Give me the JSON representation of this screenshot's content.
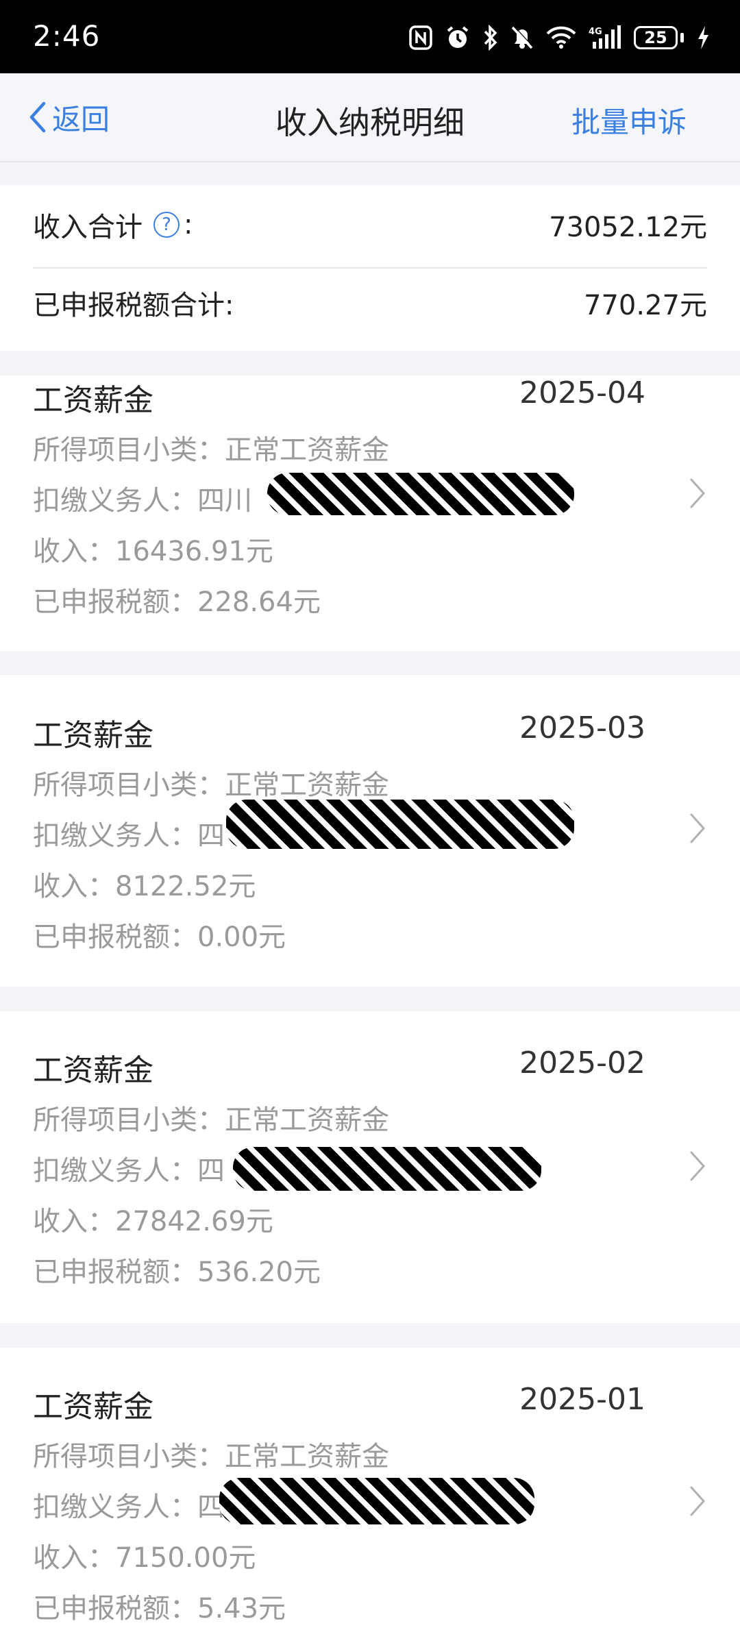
{
  "status_bar": {
    "time": "2:46",
    "battery": "25",
    "icons": [
      "nfc-icon",
      "alarm-icon",
      "bluetooth-icon",
      "mute-icon",
      "wifi-icon",
      "signal-4g-icon",
      "battery-icon",
      "charging-icon"
    ]
  },
  "nav": {
    "back_label": "返回",
    "title": "收入纳税明细",
    "action_label": "批量申诉"
  },
  "summary": {
    "income_label": "收入合计",
    "income_colon": ":",
    "income_value": "73052.12元",
    "tax_label": "已申报税额合计:",
    "tax_value": "770.27元"
  },
  "records": [
    {
      "type": "工资薪金",
      "date": "2025-04",
      "subcategory": "所得项目小类：正常工资薪金",
      "withholder": "扣缴义务人：四川",
      "income": "收入：16436.91元",
      "tax": "已申报税额：228.64元"
    },
    {
      "type": "工资薪金",
      "date": "2025-03",
      "subcategory": "所得项目小类：正常工资薪金",
      "withholder": "扣缴义务人：四",
      "income": "收入：8122.52元",
      "tax": "已申报税额：0.00元"
    },
    {
      "type": "工资薪金",
      "date": "2025-02",
      "subcategory": "所得项目小类：正常工资薪金",
      "withholder": "扣缴义务人：四",
      "income": "收入：27842.69元",
      "tax": "已申报税额：536.20元"
    },
    {
      "type": "工资薪金",
      "date": "2025-01",
      "subcategory": "所得项目小类：正常工资薪金",
      "withholder": "扣缴义务人：四",
      "income": "收入：7150.00元",
      "tax": "已申报税额：5.43元"
    }
  ],
  "colors": {
    "accent": "#3b7fe0",
    "background": "#f4f5f9",
    "secondary_text": "#9a9a9a"
  }
}
